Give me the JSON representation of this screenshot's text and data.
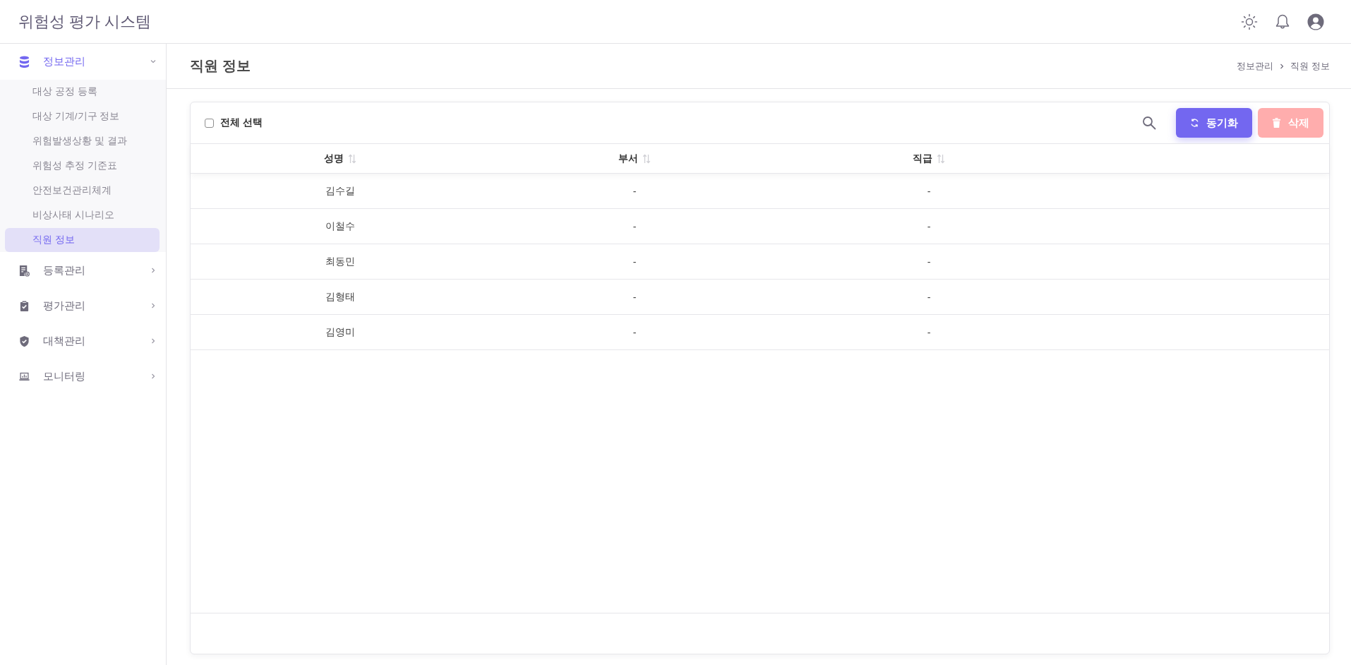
{
  "header": {
    "title": "위험성 평가 시스템"
  },
  "sidebar": {
    "items": [
      {
        "label": "정보관리",
        "selected": true,
        "expanded": true,
        "children": [
          {
            "label": "대상 공정 등록",
            "selected": false
          },
          {
            "label": "대상 기계/기구 정보",
            "selected": false
          },
          {
            "label": "위험발생상황 및 결과",
            "selected": false
          },
          {
            "label": "위험성 추정 기준표",
            "selected": false
          },
          {
            "label": "안전보건관리체계",
            "selected": false
          },
          {
            "label": "비상사태 시나리오",
            "selected": false
          },
          {
            "label": "직원 정보",
            "selected": true
          }
        ]
      },
      {
        "label": "등록관리",
        "selected": false,
        "expanded": false
      },
      {
        "label": "평가관리",
        "selected": false,
        "expanded": false
      },
      {
        "label": "대책관리",
        "selected": false,
        "expanded": false
      },
      {
        "label": "모니터링",
        "selected": false,
        "expanded": false
      }
    ]
  },
  "page": {
    "title": "직원 정보",
    "breadcrumb": [
      "정보관리",
      "직원 정보"
    ]
  },
  "toolbar": {
    "select_all": {
      "label": "전체 선택",
      "checked": false
    },
    "buttons": [
      {
        "kind": "sync",
        "label": "동기화",
        "disabled": false
      },
      {
        "kind": "delete",
        "label": "삭제",
        "disabled": true
      }
    ]
  },
  "table": {
    "columns": [
      {
        "label": "성명"
      },
      {
        "label": "부서"
      },
      {
        "label": "직급"
      }
    ],
    "rows": [
      {
        "cells": [
          "김수길",
          "-",
          "-"
        ]
      },
      {
        "cells": [
          "이철수",
          "-",
          "-"
        ]
      },
      {
        "cells": [
          "최동민",
          "-",
          "-"
        ]
      },
      {
        "cells": [
          "김형태",
          "-",
          "-"
        ]
      },
      {
        "cells": [
          "김영미",
          "-",
          "-"
        ]
      }
    ]
  }
}
